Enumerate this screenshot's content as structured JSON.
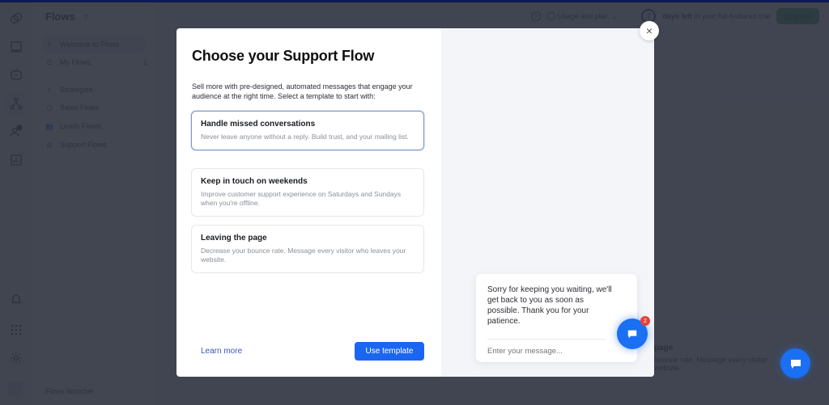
{
  "app": {
    "page_title": "Flows",
    "help_marker": "?",
    "rail_icons": [
      "conversations-icon",
      "inbox-icon",
      "bot-icon",
      "flows-icon",
      "contacts-icon",
      "analytics-icon",
      "notifications-icon",
      "apps-icon",
      "settings-icon",
      "avatar-icon"
    ],
    "subnav": {
      "items": [
        {
          "label": "Welcome to Flows",
          "icon": "stethoscope-icon",
          "active": true
        },
        {
          "label": "My Flows",
          "icon": "list-icon",
          "count": "1"
        },
        {
          "label": "Strategies",
          "icon": "stethoscope-icon"
        },
        {
          "label": "Sales Flows",
          "icon": "bag-icon"
        },
        {
          "label": "Leads Flows",
          "icon": "users-icon"
        },
        {
          "label": "Support Flows",
          "icon": "lifebuoy-icon"
        }
      ],
      "footer_label": "Flows launcher"
    },
    "topbar": {
      "help": "?",
      "usage_label": "Usage and plan",
      "days_left": "7",
      "days_left_bold": "days left",
      "days_left_rest": "in your full-featured trial",
      "upgrade_label": "Upgrade"
    },
    "background_fragment": {
      "title": "page",
      "desc_line1": "bounce rate. Message every visitor",
      "desc_line2": "website."
    }
  },
  "modal": {
    "title": "Choose your Support Flow",
    "intro": "Sell more with pre-designed, automated messages that engage your audience at the right time. Select a template to start with:",
    "templates": [
      {
        "title": "Handle missed conversations",
        "description": "Never leave anyone without a reply. Build trust, and your mailing list.",
        "selected": true
      },
      {
        "title": "Keep in touch on weekends",
        "description": "Improve customer support experience on Saturdays and Sundays when you're offline.",
        "selected": false
      },
      {
        "title": "Leaving the page",
        "description": "Decrease your bounce rate. Message every visitor who leaves your website.",
        "selected": false
      }
    ],
    "learn_more": "Learn more",
    "use_template": "Use template",
    "close": "×",
    "preview": {
      "message": "Sorry for keeping you waiting, we'll get back to you as soon as possible. Thank you for your patience.",
      "input_placeholder": "Enter your message...",
      "badge_count": "2"
    }
  },
  "colors": {
    "primary": "#1a66f0",
    "upgrade": "#1f9b5a",
    "badge": "#e5413a",
    "overlay": "#2d323e"
  }
}
